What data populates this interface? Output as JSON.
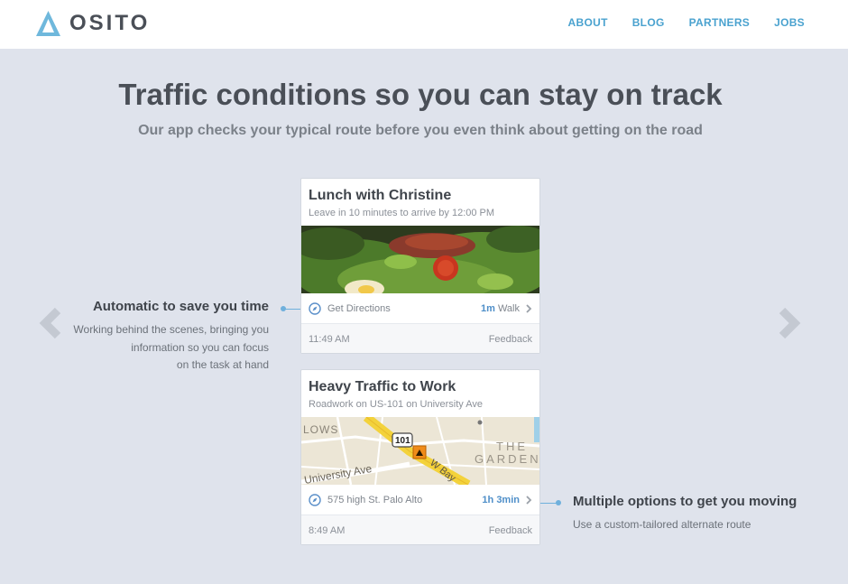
{
  "header": {
    "logo_text": "OSITO",
    "nav": [
      "ABOUT",
      "BLOG",
      "PARTNERS",
      "JOBS"
    ]
  },
  "hero": {
    "title": "Traffic conditions so you can stay on track",
    "subtitle": "Our app checks your typical route before you even think about getting on the road"
  },
  "cards": [
    {
      "title": "Lunch with Christine",
      "subtitle": "Leave in 10 minutes to arrive by 12:00 PM",
      "row_label": "Get Directions",
      "row_value": "1m",
      "row_unit": " Walk",
      "time": "11:49 AM",
      "feedback": "Feedback",
      "image": "salad-photo"
    },
    {
      "title": "Heavy Traffic to Work",
      "subtitle": "Roadwork on US-101 on University Ave",
      "row_label": "575 high St. Palo Alto",
      "row_value": "1h 3min",
      "row_unit": "",
      "time": "8:49 AM",
      "feedback": "Feedback",
      "image": "map-view",
      "map_labels": [
        "LOWS",
        "101",
        "THE",
        "GARDEN",
        "University Ave",
        "W Bay"
      ]
    }
  ],
  "features": {
    "left": {
      "title": "Automatic to save you time",
      "lines": [
        "Working behind the scenes, bringing you",
        "information so you can focus",
        "on the task at hand"
      ]
    },
    "right": {
      "title": "Multiple options to get you moving",
      "lines": [
        "Use a custom-tailored alternate route"
      ]
    }
  },
  "colors": {
    "background": "#dfe3ec",
    "accent": "#4aa2cf",
    "connector": "#6fb0dc",
    "text_dark": "#3f444b"
  },
  "icons": [
    "logo-triangle-icon",
    "arrow-left-icon",
    "arrow-right-icon",
    "compass-icon",
    "chevron-right-icon",
    "construction-icon"
  ]
}
